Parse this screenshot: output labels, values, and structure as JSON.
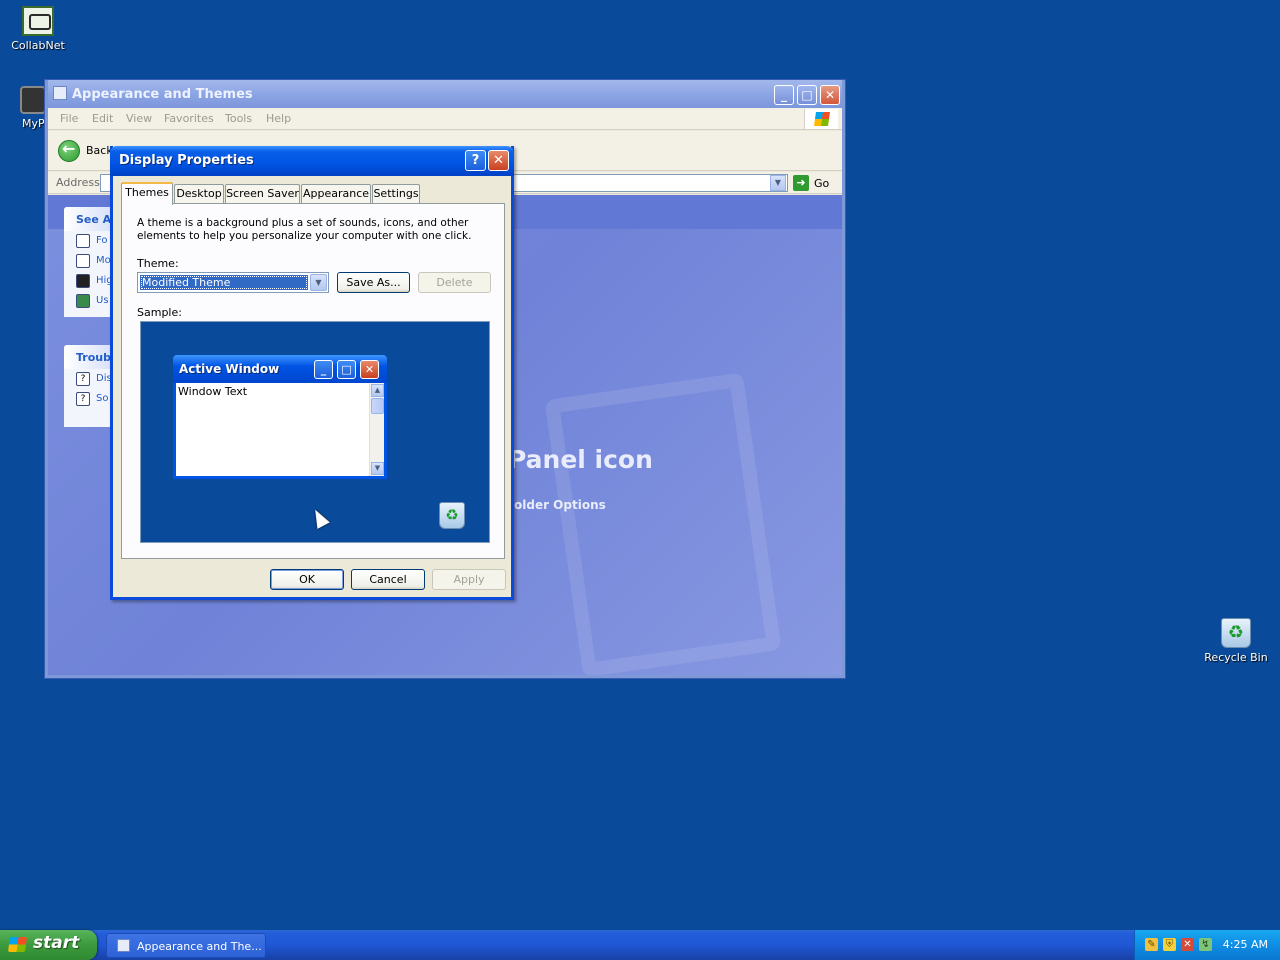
{
  "desktop": {
    "icons": [
      {
        "label": "CollabNet",
        "icon": "collabnet-icon"
      },
      {
        "label": "MyPa",
        "icon": "my-pc-icon"
      },
      {
        "label": "Recycle Bin",
        "icon": "recycle-bin-icon"
      }
    ]
  },
  "explorer": {
    "title": "Appearance and Themes",
    "menu": [
      "File",
      "Edit",
      "View",
      "Favorites",
      "Tools",
      "Help"
    ],
    "toolbar": {
      "back_label": "Back"
    },
    "address": {
      "label": "Address",
      "go_label": "Go"
    },
    "sidebar": {
      "see_also": {
        "title": "See Al",
        "items": [
          "Fo",
          "Mo",
          "Hig",
          "Us"
        ]
      },
      "troubleshooters": {
        "title": "Troubl",
        "items": [
          "Dis",
          "So"
        ]
      }
    },
    "content": {
      "heading": "Panel icon",
      "link": "older Options"
    }
  },
  "dialog": {
    "title": "Display Properties",
    "tabs": [
      "Themes",
      "Desktop",
      "Screen Saver",
      "Appearance",
      "Settings"
    ],
    "active_tab": "Themes",
    "description": "A theme is a background plus a set of sounds, icons, and other elements to help you personalize your computer with one click.",
    "theme_label": "Theme:",
    "theme_value": "Modified Theme",
    "save_as_label": "Save As...",
    "delete_label": "Delete",
    "sample_label": "Sample:",
    "sample_window": {
      "title": "Active Window",
      "text": "Window Text"
    },
    "buttons": {
      "ok": "OK",
      "cancel": "Cancel",
      "apply": "Apply"
    }
  },
  "taskbar": {
    "start_label": "start",
    "items": [
      {
        "label": "Appearance and The..."
      }
    ],
    "clock": "4:25 AM"
  }
}
